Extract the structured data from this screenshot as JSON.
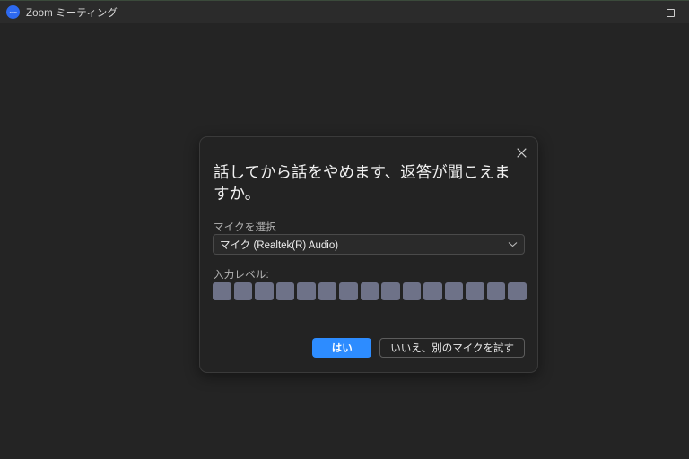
{
  "window": {
    "title": "Zoom ミーティング",
    "logo_icon": "zoom-logo-icon",
    "logo_text": "zoom",
    "controls": {
      "minimize": "minimize-icon",
      "maximize": "maximize-icon"
    }
  },
  "dialog": {
    "heading": "話してから話をやめます、返答が聞こえますか。",
    "close_icon": "close-icon",
    "mic_select": {
      "label": "マイクを選択",
      "value": "マイク (Realtek(R) Audio)",
      "chevron_icon": "chevron-down-icon",
      "options": [
        "マイク (Realtek(R) Audio)"
      ]
    },
    "input_level": {
      "label": "入力レベル:",
      "segment_count": 15,
      "segment_color": "#6e7288",
      "active_segments": 0
    },
    "actions": {
      "primary_label": "はい",
      "secondary_label": "いいえ、別のマイクを試す"
    }
  },
  "colors": {
    "accent": "#2D8CFF",
    "logo_blue": "#2D69F0",
    "window_background": "#242424",
    "titlebar_background": "#2b2b2b",
    "dialog_background": "#232323",
    "meter_segment": "#6e7288"
  }
}
